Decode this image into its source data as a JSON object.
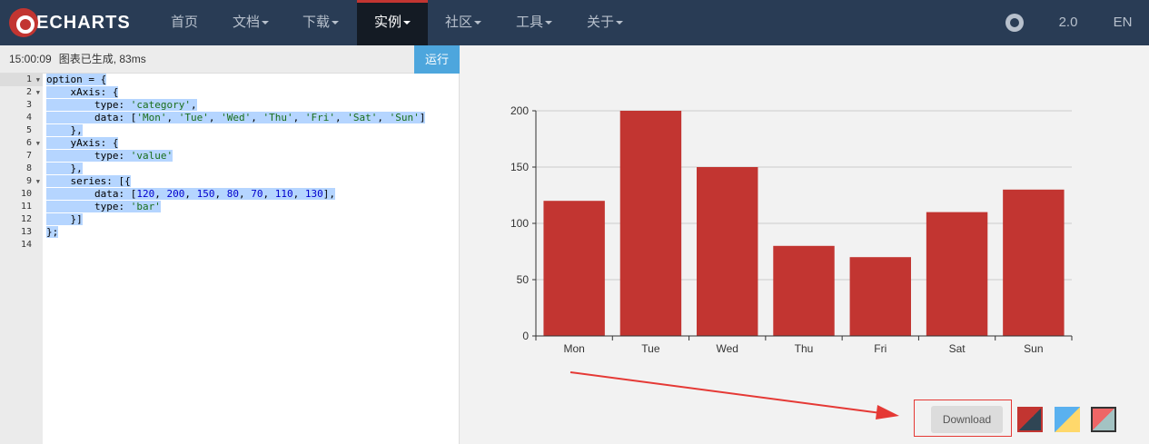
{
  "navbar": {
    "logo_text": "ECHARTS",
    "items": [
      {
        "label": "首页",
        "caret": false
      },
      {
        "label": "文档",
        "caret": true
      },
      {
        "label": "下载",
        "caret": true
      },
      {
        "label": "实例",
        "caret": true,
        "active": true
      },
      {
        "label": "社区",
        "caret": true
      },
      {
        "label": "工具",
        "caret": true
      },
      {
        "label": "关于",
        "caret": true
      }
    ],
    "version": "2.0",
    "language": "EN"
  },
  "status": {
    "time": "15:00:09",
    "message": "图表已生成, 83ms"
  },
  "run_button_label": "运行",
  "editor": {
    "line_numbers": [
      "1",
      "2",
      "3",
      "4",
      "5",
      "6",
      "7",
      "8",
      "9",
      "10",
      "11",
      "12",
      "13",
      "14"
    ]
  },
  "chart_data": {
    "type": "bar",
    "categories": [
      "Mon",
      "Tue",
      "Wed",
      "Thu",
      "Fri",
      "Sat",
      "Sun"
    ],
    "values": [
      120,
      200,
      150,
      80,
      70,
      110,
      130
    ],
    "ylim": [
      0,
      200
    ],
    "yticks": [
      0,
      50,
      100,
      150,
      200
    ],
    "grid": true,
    "bar_color": "#c23531"
  },
  "download_label": "Download",
  "theme_icons": [
    "theme-red-icon",
    "theme-blue-icon",
    "theme-gray-icon"
  ]
}
